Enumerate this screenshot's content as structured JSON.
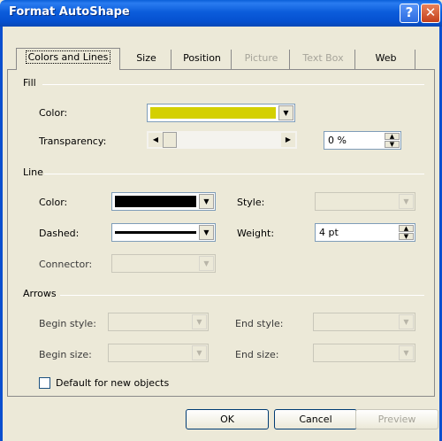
{
  "window": {
    "title": "Format AutoShape",
    "help_glyph": "?",
    "close_glyph": "✕"
  },
  "tabs": [
    {
      "label": "Colors and Lines",
      "active": true,
      "enabled": true
    },
    {
      "label": "Size",
      "active": false,
      "enabled": true
    },
    {
      "label": "Position",
      "active": false,
      "enabled": true
    },
    {
      "label": "Picture",
      "active": false,
      "enabled": false
    },
    {
      "label": "Text Box",
      "active": false,
      "enabled": false
    },
    {
      "label": "Web",
      "active": false,
      "enabled": true
    }
  ],
  "fill": {
    "group_label": "Fill",
    "color_label": "Color:",
    "color_value": "#d4d000",
    "transparency_label": "Transparency:",
    "transparency_value": "0 %",
    "transparency_level": 0
  },
  "line": {
    "group_label": "Line",
    "color_label": "Color:",
    "color_value": "#000000",
    "dashed_label": "Dashed:",
    "connector_label": "Connector:",
    "style_label": "Style:",
    "weight_label": "Weight:",
    "weight_value": "4 pt"
  },
  "arrows": {
    "group_label": "Arrows",
    "begin_style_label": "Begin style:",
    "begin_size_label": "Begin size:",
    "end_style_label": "End style:",
    "end_size_label": "End size:"
  },
  "default_checkbox": {
    "label": "Default for new objects",
    "checked": false
  },
  "buttons": {
    "ok": "OK",
    "cancel": "Cancel",
    "preview": "Preview"
  }
}
